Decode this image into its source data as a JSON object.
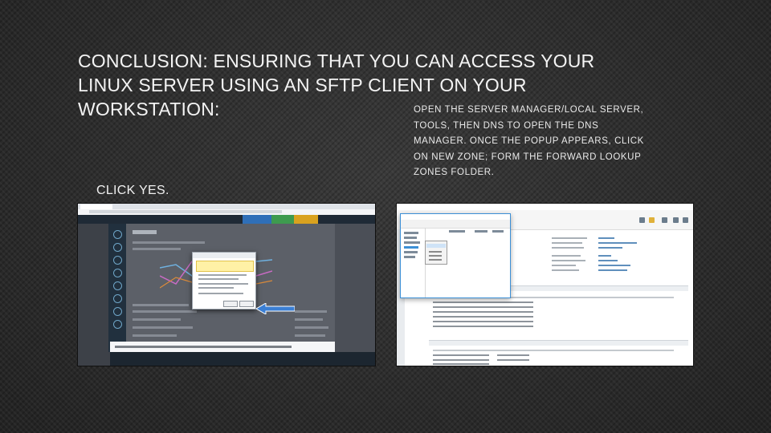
{
  "title": {
    "lines": [
      "CONCLUSION: ENSURING THAT YOU CAN ACCESS YOUR",
      "LINUX SERVER USING AN SFTP CLIENT ON YOUR",
      "WORKSTATION:"
    ]
  },
  "instructions": {
    "lines": [
      "Open the server Manager/local server,",
      "Tools, then DNS to open the DNS",
      "Manager. once the popup appears, click",
      "on New Zone; form the forward lookup",
      "zones folder."
    ]
  },
  "caption_left": "Click yes.",
  "colors": {
    "background": "#2b2b2b",
    "text": "#f0f0f0",
    "console_header": "#1f2a36",
    "dialog_warning": "#fff1a6",
    "callout_arrow": "#3b7fd4",
    "dns_window_border": "#3b8fd6"
  },
  "screenshots": {
    "left": {
      "description_icon": "web-console-screenshot"
    },
    "right": {
      "description_icon": "server-manager-screenshot"
    }
  }
}
